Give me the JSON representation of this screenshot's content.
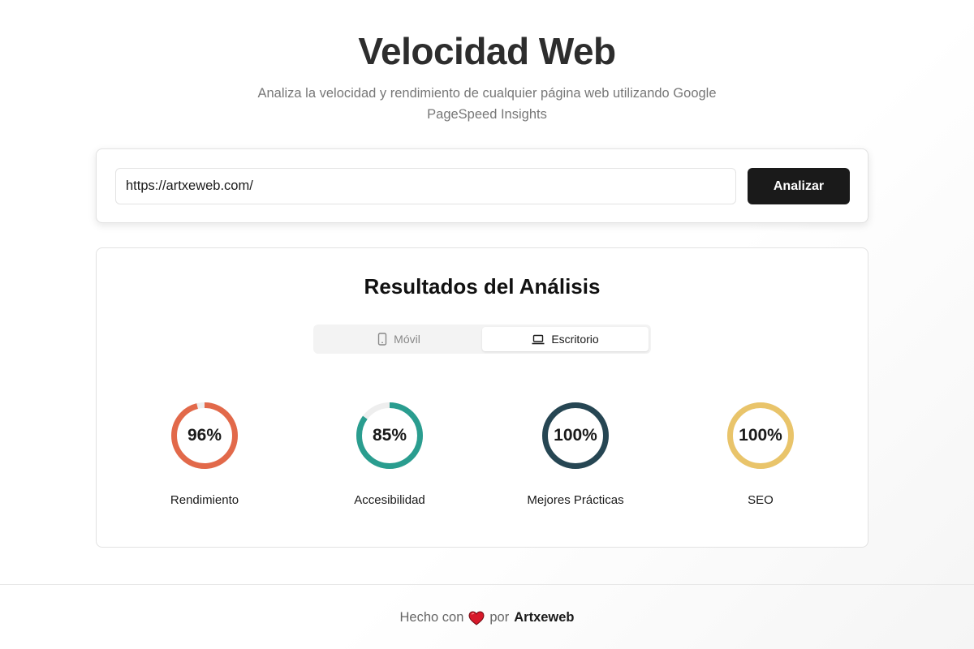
{
  "header": {
    "title": "Velocidad Web",
    "subtitle": "Analiza la velocidad y rendimiento de cualquier página web utilizando Google PageSpeed Insights"
  },
  "search": {
    "value": "https://artxeweb.com/",
    "button_label": "Analizar"
  },
  "results": {
    "title": "Resultados del Análisis",
    "tabs": [
      {
        "label": "Móvil",
        "icon": "smartphone-icon",
        "active": false
      },
      {
        "label": "Escritorio",
        "icon": "laptop-icon",
        "active": true
      }
    ],
    "metrics": [
      {
        "label": "Rendimiento",
        "value": 96,
        "display": "96%",
        "color": "#e2694a"
      },
      {
        "label": "Accesibilidad",
        "value": 85,
        "display": "85%",
        "color": "#2a9d8f"
      },
      {
        "label": "Mejores Prácticas",
        "value": 100,
        "display": "100%",
        "color": "#264653"
      },
      {
        "label": "SEO",
        "value": 100,
        "display": "100%",
        "color": "#e9c46a"
      }
    ]
  },
  "footer": {
    "prefix": "Hecho con",
    "icon": "heart-icon",
    "middle": "por",
    "brand": "Artxeweb"
  }
}
